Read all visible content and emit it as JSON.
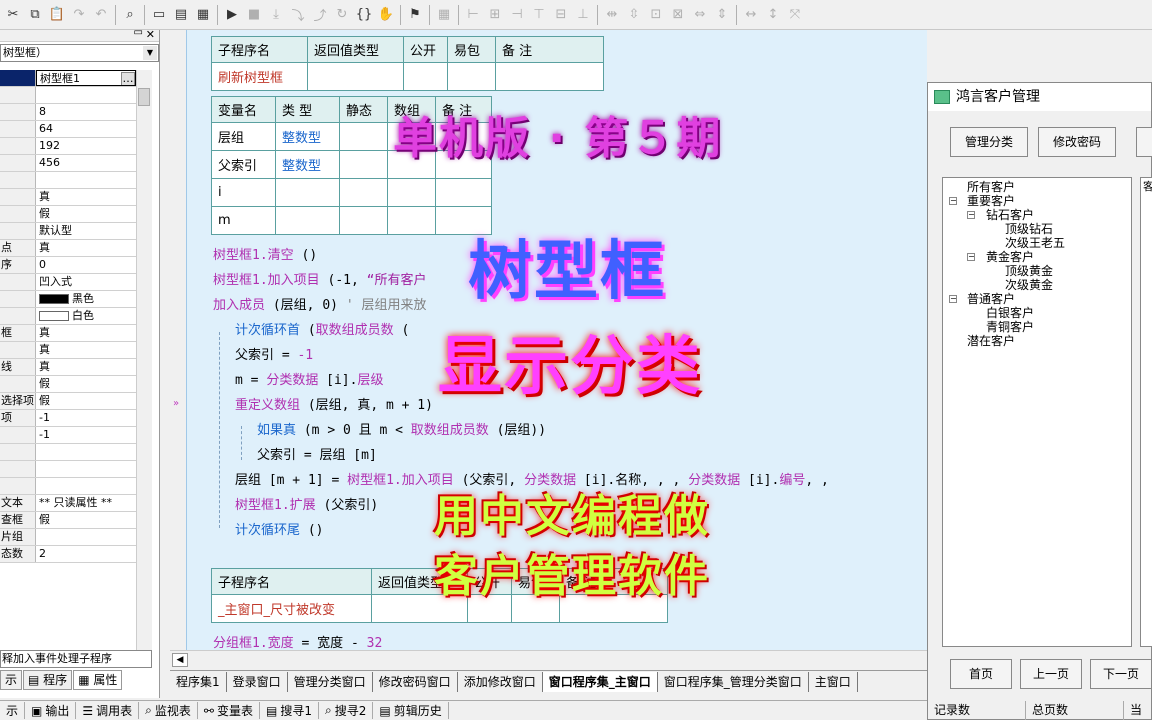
{
  "toolbar": {
    "icons": [
      "cut-icon",
      "copy-icon",
      "paste-icon",
      "redo-icon",
      "undo-icon",
      "find-icon",
      "layout1-icon",
      "layout2-icon",
      "layout3-icon",
      "run-icon",
      "stop-icon",
      "step-icon",
      "step-into-icon",
      "step-out-icon",
      "step-over-icon",
      "brace-icon",
      "hand-icon",
      "debug-icon",
      "grid-icon",
      "align-left-icon",
      "align-center-icon",
      "align-right-icon",
      "align-top-icon",
      "align-middle-icon",
      "align-bottom-icon",
      "space-h-icon",
      "space-v-icon",
      "center-h-icon",
      "width-icon",
      "height-icon",
      "size-icon"
    ]
  },
  "props": {
    "combo": "树型框）",
    "rows": [
      {
        "k": "",
        "v": "树型框1"
      },
      {
        "k": "",
        "v": ""
      },
      {
        "k": "",
        "v": "8"
      },
      {
        "k": "",
        "v": "64"
      },
      {
        "k": "",
        "v": "192"
      },
      {
        "k": "",
        "v": "456"
      },
      {
        "k": "",
        "v": ""
      },
      {
        "k": "",
        "v": "真"
      },
      {
        "k": "",
        "v": "假"
      },
      {
        "k": "",
        "v": "默认型"
      },
      {
        "k": "点",
        "v": "真"
      },
      {
        "k": "序",
        "v": "0"
      },
      {
        "k": "",
        "v": "凹入式"
      },
      {
        "k": "",
        "v": "黑色"
      },
      {
        "k": "",
        "v": "白色"
      },
      {
        "k": "框",
        "v": "真"
      },
      {
        "k": "",
        "v": "真"
      },
      {
        "k": "线",
        "v": "真"
      },
      {
        "k": "",
        "v": "假"
      },
      {
        "k": "选择项",
        "v": "假"
      },
      {
        "k": "项",
        "v": "-1"
      },
      {
        "k": "",
        "v": "-1"
      },
      {
        "k": "",
        "v": ""
      },
      {
        "k": "",
        "v": ""
      },
      {
        "k": "",
        "v": ""
      },
      {
        "k": "文本",
        "v": "** 只读属性 **"
      },
      {
        "k": "查框",
        "v": "假"
      },
      {
        "k": "片组",
        "v": ""
      },
      {
        "k": "态数",
        "v": "2"
      }
    ],
    "bottom": "释加入事件处理子程序",
    "tab_support": "示",
    "tab_program": "程序",
    "tab_props": "属性"
  },
  "sub1": {
    "headers": [
      "子程序名",
      "返回值类型",
      "公开",
      "易包",
      "备 注"
    ],
    "name": "刷新树型框"
  },
  "vars": {
    "headers": [
      "变量名",
      "类 型",
      "静态",
      "数组",
      "备 注"
    ],
    "rows": [
      [
        "层组",
        "整数型"
      ],
      [
        "父索引",
        "整数型"
      ],
      [
        "i",
        ""
      ],
      [
        "m",
        ""
      ]
    ]
  },
  "code": {
    "l1_obj": "树型框1.",
    "l1_fn": "清空",
    "l1_args": " ()",
    "l2_obj": "树型框1.",
    "l2_fn": "加入项目",
    "l2_args": " (-1, ",
    "l2_str": "“所有客户",
    "l3_fn": "加入成员",
    "l3_args": " (层组, 0)  ",
    "l3_cmt": "' 层组用来放",
    "l4_kw": "计次循环首",
    "l4_args": " (",
    "l4_fn": "取数组成员数",
    "l4_rest": " (",
    "l5": "父索引 = ",
    "l5_num": "-1",
    "l6": "m = ",
    "l6_var": "分类数据",
    "l6_rest": " [i].",
    "l6_field": "层级",
    "l7_fn": "重定义数组",
    "l7_args": " (层组, 真, m + 1)",
    "l8_kw": "如果真",
    "l8_args": " (m > 0 且 m < ",
    "l8_fn": "取数组成员数",
    "l8_rest": " (层组))",
    "l9": "父索引 = 层组 [m]",
    "l10": "层组 [m + 1] = ",
    "l10_obj": "树型框1.",
    "l10_fn": "加入项目",
    "l10_a": " (父索引, ",
    "l10_var": "分类数据",
    "l10_b": " [i].名称, , , ",
    "l10_var2": "分类数据",
    "l10_c": " [i].",
    "l10_field": "编号",
    "l10_d": ", ,",
    "l11_obj": "树型框1.",
    "l11_fn": "扩展",
    "l11_args": " (父索引)",
    "l12_kw": "计次循环尾",
    "l12_args": " ()",
    "l13_obj": "分组框1.",
    "l13_prop": "宽度",
    "l13_rest": " = 宽度 - ",
    "l13_num": "32"
  },
  "sub2": {
    "headers": [
      "子程序名",
      "返回值类型",
      "公开",
      "易包",
      "备 注"
    ],
    "name": "_主窗口_尺寸被改变"
  },
  "overlay": {
    "line1": "单机版 · 第５期",
    "line2": "树型框",
    "line3": "显示分类",
    "line4": "用中文编程做",
    "line5": "客户管理软件"
  },
  "tabs": [
    "程序集1",
    "登录窗口",
    "管理分类窗口",
    "修改密码窗口",
    "添加修改窗口",
    "窗口程序集_主窗口",
    "窗口程序集_管理分类窗口",
    "主窗口"
  ],
  "status": [
    "示",
    "输出",
    "调用表",
    "监视表",
    "变量表",
    "搜寻1",
    "搜寻2",
    "剪辑历史"
  ],
  "app": {
    "title": "鸿言客户管理",
    "btn_manage": "管理分类",
    "btn_pwd": "修改密码",
    "tree": [
      "所有客户",
      "重要客户",
      "钻石客户",
      "顶级钻石",
      "次级王老五",
      "黄金客户",
      "顶级黄金",
      "次级黄金",
      "普通客户",
      "白银客户",
      "青铜客户",
      "潜在客户"
    ],
    "list_header": "客",
    "btn_first": "首页",
    "btn_prev": "上一页",
    "btn_next": "下一页",
    "foot_records": "记录数",
    "foot_pages": "总页数",
    "foot_current": "当前"
  }
}
